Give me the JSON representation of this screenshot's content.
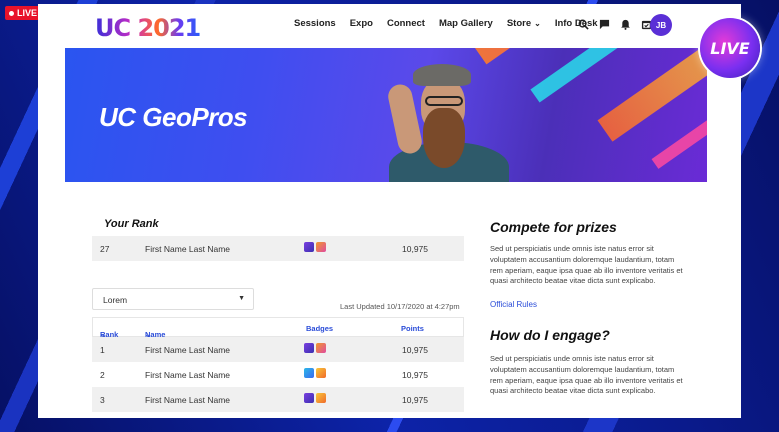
{
  "live_badge": "LIVE",
  "live_round": "LIVE",
  "header": {
    "logo": "UC 2021",
    "nav": [
      {
        "label": "Sessions"
      },
      {
        "label": "Expo"
      },
      {
        "label": "Connect"
      },
      {
        "label": "Map Gallery"
      },
      {
        "label": "Store",
        "chevron": "⌄"
      },
      {
        "label": "Info Desk",
        "chevron": "⌄"
      }
    ],
    "icons": [
      "search-icon",
      "chat-icon",
      "bell-icon",
      "calendar-icon"
    ],
    "avatar_initials": "JB"
  },
  "hero": {
    "title": "UC GeoPros"
  },
  "your_rank": {
    "title": "Your Rank",
    "row": {
      "rank": "27",
      "name": "First Name Last Name",
      "badges": [
        "purple",
        "orange"
      ],
      "points": "10,975"
    }
  },
  "filter": {
    "selected": "Lorem",
    "last_updated": "Last Updated 10/17/2020 at 4:27pm"
  },
  "table": {
    "headers": {
      "rank": "Rank",
      "name": "Name",
      "badges": "Badges",
      "points": "Points"
    },
    "rows": [
      {
        "rank": "1",
        "name": "First Name Last Name",
        "badges": [
          "purple",
          "orange"
        ],
        "points": "10,975"
      },
      {
        "rank": "2",
        "name": "First Name Last Name",
        "badges": [
          "blue",
          "yellow"
        ],
        "points": "10,975"
      },
      {
        "rank": "3",
        "name": "First Name Last Name",
        "badges": [
          "purple",
          "yellow"
        ],
        "points": "10,975"
      }
    ]
  },
  "sidebar": {
    "compete_title": "Compete for prizes",
    "compete_body": "Sed ut perspiciatis unde omnis iste natus error sit voluptatem accusantium doloremque laudantium, totam rem aperiam, eaque ipsa quae ab illo inventore veritatis et quasi architecto beatae vitae dicta sunt explicabo.",
    "official_rules": "Official Rules",
    "engage_title": "How do I engage?",
    "engage_body": "Sed ut perspiciatis unde omnis iste natus error sit voluptatem accusantium doloremque laudantium, totam rem aperiam, eaque ipsa quae ab illo inventore veritatis et quasi architecto beatae vitae dicta sunt explicabo."
  }
}
